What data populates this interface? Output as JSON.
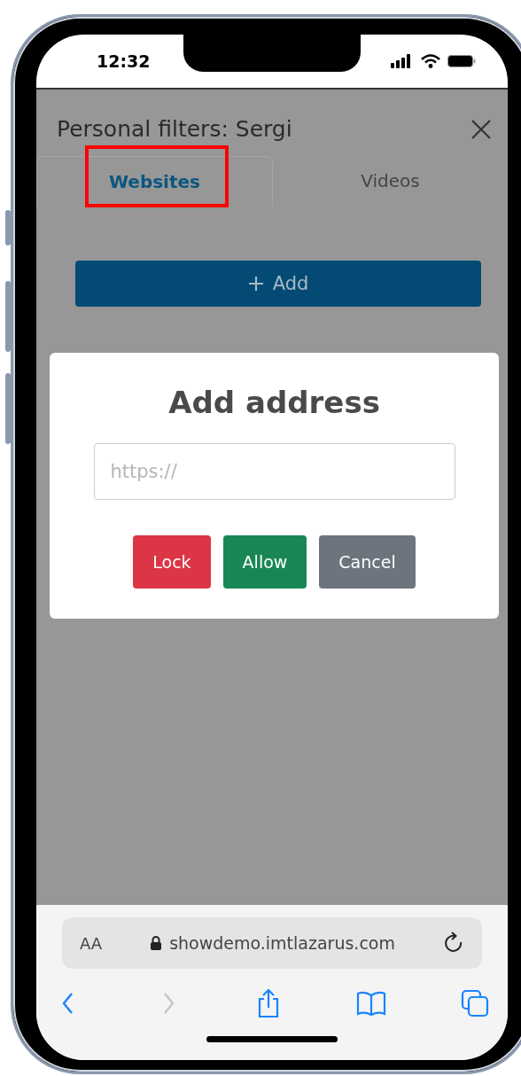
{
  "status_bar": {
    "time": "12:32"
  },
  "panel": {
    "title": "Personal filters: Sergi"
  },
  "tabs": [
    {
      "label": "Websites",
      "selected": true,
      "highlighted": true
    },
    {
      "label": "Videos",
      "selected": false,
      "highlighted": false
    }
  ],
  "add_button": {
    "label": "Add"
  },
  "dialog": {
    "title": "Add address",
    "field": {
      "placeholder": "https://"
    },
    "buttons": [
      {
        "label": "Lock",
        "kind": "danger"
      },
      {
        "label": "Allow",
        "kind": "success"
      },
      {
        "label": "Cancel",
        "kind": "secondary"
      }
    ]
  },
  "browser": {
    "text_size": "AA",
    "url": "showdemo.imtlazarus.com",
    "toolbar": [
      {
        "kind": "back",
        "disabled": false
      },
      {
        "kind": "forward",
        "disabled": true
      },
      {
        "kind": "share",
        "disabled": false
      },
      {
        "kind": "bookmarks",
        "disabled": false
      },
      {
        "kind": "tabs",
        "disabled": false
      }
    ]
  }
}
